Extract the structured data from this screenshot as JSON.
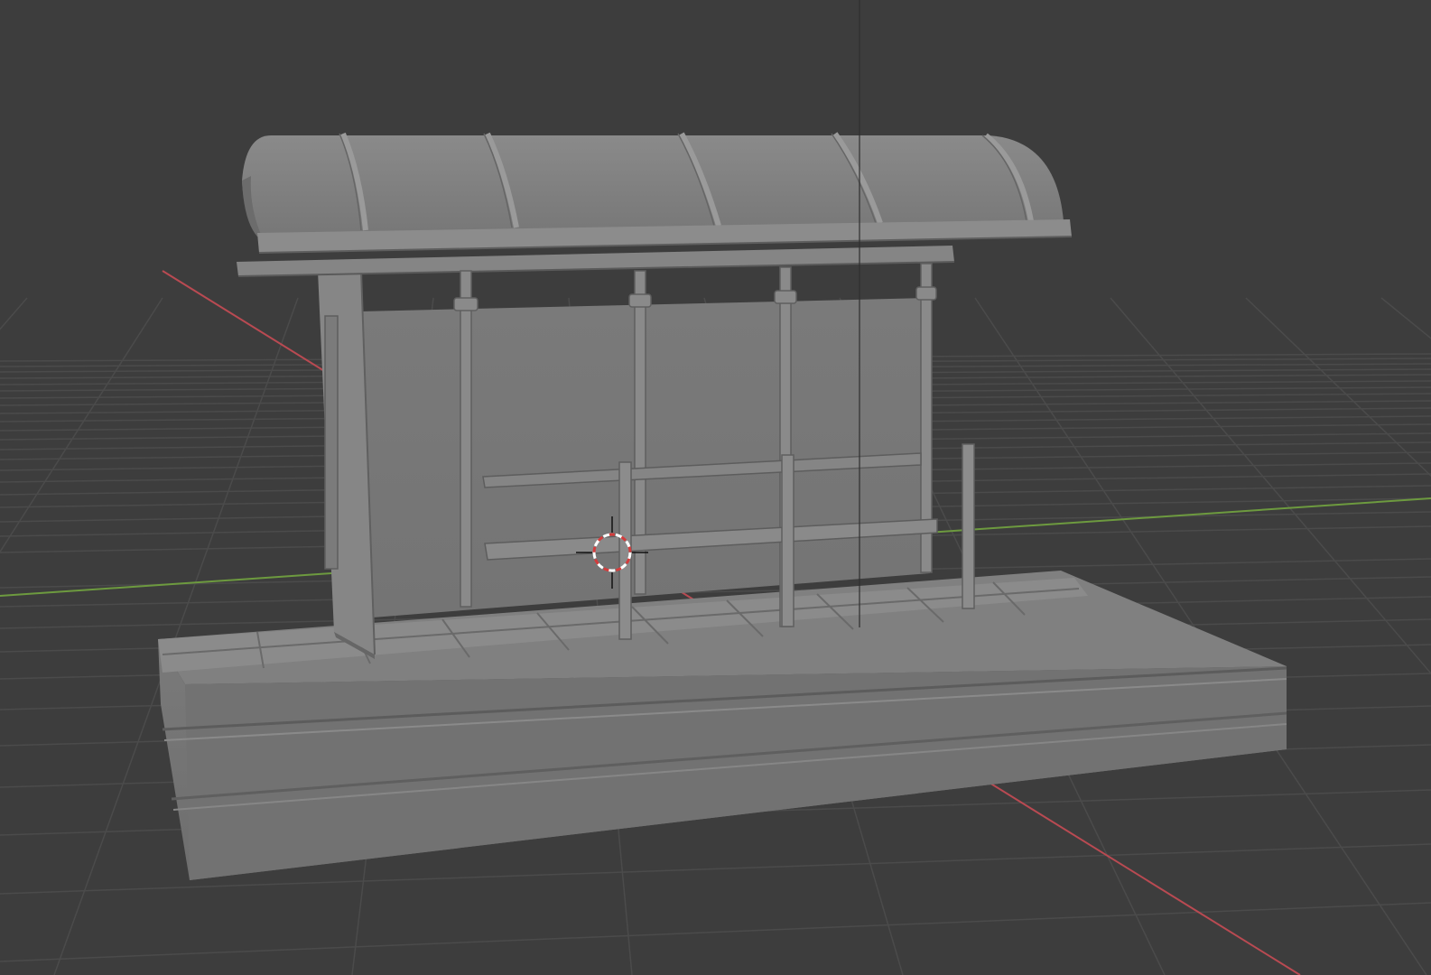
{
  "app": {
    "view": "3d-viewport",
    "shading": "solid"
  },
  "viewport": {
    "background_color": "#3d3d3d",
    "grid_color": "#4a4a4a",
    "x_axis_color": "#b94a52",
    "y_axis_color": "#6d9a3f",
    "model_color": "#7c7c7c",
    "cursor_icon": "3d-cursor-icon"
  }
}
